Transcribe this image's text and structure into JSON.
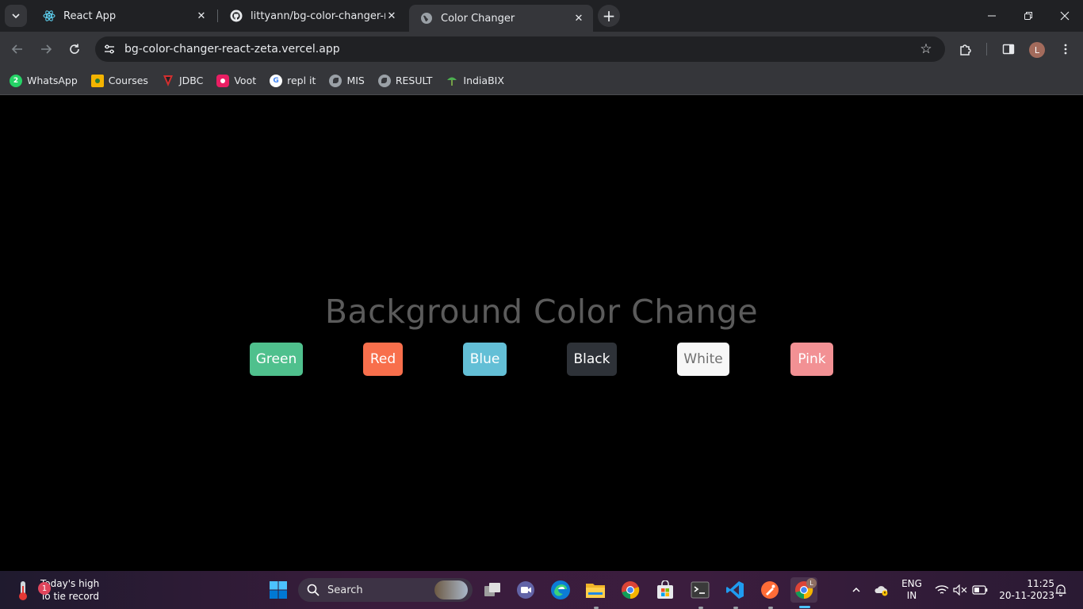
{
  "browser": {
    "tabs": [
      {
        "title": "React App",
        "favicon": "react-icon"
      },
      {
        "title": "littyann/bg-color-changer-react",
        "favicon": "github-icon"
      },
      {
        "title": "Color Changer",
        "favicon": "globe-icon",
        "active": true
      }
    ],
    "url": "bg-color-changer-react-zeta.vercel.app",
    "profile_initial": "L",
    "bookmarks": [
      {
        "label": "WhatsApp",
        "icon": "whatsapp-icon",
        "color": "#25d366",
        "glyph": "2"
      },
      {
        "label": "Courses",
        "icon": "courses-icon",
        "color": "#f4b400",
        "glyph": ""
      },
      {
        "label": "JDBC",
        "icon": "jdbc-icon",
        "color": "#d32f2f",
        "glyph": ""
      },
      {
        "label": "Voot",
        "icon": "voot-icon",
        "color": "#e91e63",
        "glyph": ""
      },
      {
        "label": "repl it",
        "icon": "google-icon",
        "color": "#ffffff",
        "glyph": "G"
      },
      {
        "label": "MIS",
        "icon": "globe-icon",
        "color": "#9aa0a6",
        "glyph": ""
      },
      {
        "label": "RESULT",
        "icon": "globe-icon",
        "color": "#9aa0a6",
        "glyph": ""
      },
      {
        "label": "IndiaBIX",
        "icon": "indiabix-icon",
        "color": "#4caf50",
        "glyph": ""
      }
    ]
  },
  "page": {
    "title": "Background Color Change",
    "buttons": [
      {
        "label": "Green",
        "bg": "#4fc08d",
        "fg": "#ffffff"
      },
      {
        "label": "Red",
        "bg": "#f86f4c",
        "fg": "#ffffff"
      },
      {
        "label": "Blue",
        "bg": "#63bfd6",
        "fg": "#ffffff"
      },
      {
        "label": "Black",
        "bg": "#2e3238",
        "fg": "#ffffff"
      },
      {
        "label": "White",
        "bg": "#f7f7f7",
        "fg": "#707070"
      },
      {
        "label": "Pink",
        "bg": "#f29194",
        "fg": "#ffffff"
      }
    ]
  },
  "taskbar": {
    "weather_line1": "Today's high",
    "weather_line2": "To tie record",
    "weather_badge": "1",
    "search_label": "Search",
    "lang_line1": "ENG",
    "lang_line2": "IN",
    "time": "11:25",
    "date": "20-11-2023",
    "chrome_badge": "L"
  }
}
